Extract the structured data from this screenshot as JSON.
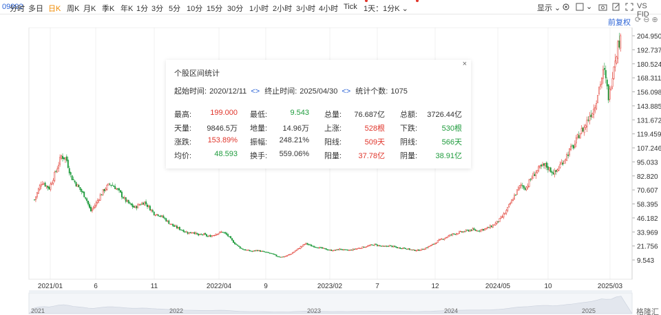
{
  "toolbar": {
    "code": "09992",
    "timeframes": [
      "分时",
      "多日",
      "日K",
      "周K",
      "月K",
      "季K",
      "年K",
      "1分",
      "3分",
      "5分",
      "10分",
      "15分",
      "30分",
      "1小时",
      "2小时",
      "3小时",
      "4小时",
      "Tick",
      "1天：1分K"
    ],
    "active": "日K",
    "display_label": "显示",
    "vs_label": "VS FID"
  },
  "restore_label": "前复权",
  "y_ticks": [
    "204.950",
    "192.737",
    "180.524",
    "168.311",
    "156.098",
    "143.885",
    "131.672",
    "119.459",
    "107.246",
    "95.033",
    "82.820",
    "70.607",
    "58.395",
    "46.182",
    "33.969",
    "21.756",
    "9.543"
  ],
  "x_ticks": [
    "2021/01",
    "6",
    "11",
    "2022/04",
    "9",
    "2023/02",
    "7",
    "12",
    "2024/05",
    "10",
    "2025/03"
  ],
  "nav_ticks": [
    "2021",
    "2022",
    "2023",
    "2024",
    "2025"
  ],
  "watermark": "格隆汇",
  "stats": {
    "title": "个股区间统计",
    "close": "×",
    "start_label": "起始时间:",
    "start_value": "2020/12/11",
    "end_label": "终止时间:",
    "end_value": "2025/04/30",
    "count_label": "统计个数:",
    "count_value": "1075",
    "rows": [
      [
        [
          "最高:",
          "199.000",
          "red"
        ],
        [
          "最低:",
          "9.543",
          "green"
        ],
        [
          "总量:",
          "76.687亿",
          "plain"
        ],
        [
          "总额:",
          "3726.44亿",
          "plain"
        ]
      ],
      [
        [
          "天量:",
          "9846.5万",
          "plain"
        ],
        [
          "地量:",
          "14.96万",
          "plain"
        ],
        [
          "上涨:",
          "528根",
          "red"
        ],
        [
          "下跌:",
          "530根",
          "green"
        ]
      ],
      [
        [
          "涨跌:",
          "153.89%",
          "red"
        ],
        [
          "振幅:",
          "248.21%",
          "plain"
        ],
        [
          "阳线:",
          "509天",
          "red"
        ],
        [
          "阴线:",
          "566天",
          "green"
        ]
      ],
      [
        [
          "均价:",
          "48.593",
          "green"
        ],
        [
          "换手:",
          "559.06%",
          "plain"
        ],
        [
          "阳量:",
          "37.78亿",
          "red"
        ],
        [
          "阴量:",
          "38.91亿",
          "green"
        ]
      ]
    ]
  },
  "chart_data": {
    "type": "candlestick",
    "x_range": [
      "2020/12/11",
      "2025/04/30"
    ],
    "ylim": [
      9.543,
      204.95
    ],
    "close_path": [
      [
        0,
        62
      ],
      [
        6,
        78
      ],
      [
        12,
        72
      ],
      [
        18,
        88
      ],
      [
        22,
        100
      ],
      [
        26,
        98
      ],
      [
        30,
        82
      ],
      [
        34,
        76
      ],
      [
        38,
        70
      ],
      [
        42,
        64
      ],
      [
        46,
        52
      ],
      [
        50,
        58
      ],
      [
        54,
        66
      ],
      [
        58,
        72
      ],
      [
        62,
        76
      ],
      [
        66,
        73
      ],
      [
        70,
        68
      ],
      [
        74,
        62
      ],
      [
        78,
        58
      ],
      [
        82,
        55
      ],
      [
        86,
        58
      ],
      [
        90,
        60
      ],
      [
        94,
        55
      ],
      [
        98,
        50
      ],
      [
        102,
        49
      ],
      [
        106,
        46
      ],
      [
        110,
        42
      ],
      [
        114,
        39
      ],
      [
        118,
        37
      ],
      [
        122,
        35
      ],
      [
        126,
        33
      ],
      [
        130,
        34
      ],
      [
        134,
        31
      ],
      [
        138,
        32
      ],
      [
        142,
        30
      ],
      [
        146,
        31
      ],
      [
        150,
        33
      ],
      [
        154,
        34
      ],
      [
        158,
        31
      ],
      [
        162,
        26
      ],
      [
        166,
        22
      ],
      [
        170,
        19
      ],
      [
        174,
        18
      ],
      [
        178,
        17
      ],
      [
        182,
        18
      ],
      [
        186,
        17
      ],
      [
        190,
        16
      ],
      [
        194,
        15
      ],
      [
        198,
        13
      ],
      [
        202,
        12
      ],
      [
        206,
        13
      ],
      [
        210,
        15
      ],
      [
        214,
        18
      ],
      [
        218,
        21
      ],
      [
        222,
        24
      ],
      [
        226,
        22
      ],
      [
        230,
        21
      ],
      [
        234,
        20
      ],
      [
        238,
        19
      ],
      [
        242,
        18
      ],
      [
        246,
        18
      ],
      [
        250,
        19
      ],
      [
        254,
        18
      ],
      [
        258,
        18
      ],
      [
        262,
        19
      ],
      [
        266,
        20
      ],
      [
        270,
        21
      ],
      [
        274,
        22
      ],
      [
        278,
        23
      ],
      [
        282,
        22
      ],
      [
        286,
        21
      ],
      [
        290,
        22
      ],
      [
        294,
        21
      ],
      [
        298,
        20
      ],
      [
        302,
        20
      ],
      [
        306,
        19
      ],
      [
        310,
        18
      ],
      [
        314,
        18
      ],
      [
        318,
        19
      ],
      [
        322,
        21
      ],
      [
        326,
        23
      ],
      [
        330,
        26
      ],
      [
        334,
        28
      ],
      [
        338,
        30
      ],
      [
        342,
        32
      ],
      [
        346,
        33
      ],
      [
        350,
        34
      ],
      [
        354,
        35
      ],
      [
        358,
        36
      ],
      [
        362,
        35
      ],
      [
        366,
        36
      ],
      [
        370,
        37
      ],
      [
        374,
        39
      ],
      [
        378,
        42
      ],
      [
        382,
        46
      ],
      [
        386,
        52
      ],
      [
        390,
        60
      ],
      [
        394,
        68
      ],
      [
        398,
        75
      ],
      [
        402,
        72
      ],
      [
        406,
        80
      ],
      [
        410,
        86
      ],
      [
        414,
        90
      ],
      [
        418,
        92
      ],
      [
        422,
        88
      ],
      [
        426,
        85
      ],
      [
        430,
        92
      ],
      [
        434,
        98
      ],
      [
        438,
        105
      ],
      [
        442,
        110
      ],
      [
        446,
        120
      ],
      [
        450,
        125
      ],
      [
        454,
        135
      ],
      [
        458,
        142
      ],
      [
        462,
        160
      ],
      [
        466,
        175
      ],
      [
        470,
        150
      ],
      [
        474,
        180
      ],
      [
        478,
        200
      ]
    ],
    "xmax": 480
  }
}
